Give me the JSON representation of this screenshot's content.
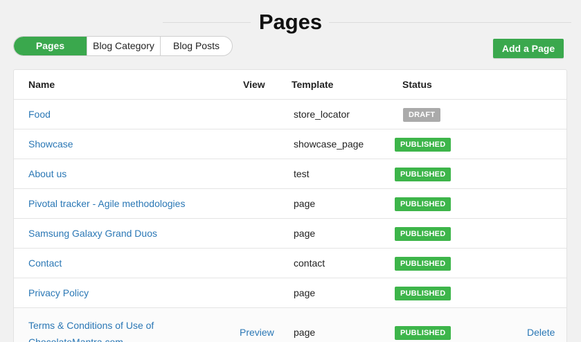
{
  "title": "Pages",
  "tabs": [
    {
      "label": "Pages",
      "active": true
    },
    {
      "label": "Blog Category",
      "active": false
    },
    {
      "label": "Blog Posts",
      "active": false
    }
  ],
  "add_button_label": "Add a Page",
  "table": {
    "headers": {
      "name": "Name",
      "view": "View",
      "template": "Template",
      "status": "Status"
    },
    "rows": [
      {
        "name": "Food",
        "view": "",
        "template": "store_locator",
        "status": "DRAFT",
        "delete": ""
      },
      {
        "name": "Showcase",
        "view": "",
        "template": "showcase_page",
        "status": "PUBLISHED",
        "delete": ""
      },
      {
        "name": "About us",
        "view": "",
        "template": "test",
        "status": "PUBLISHED",
        "delete": ""
      },
      {
        "name": "Pivotal tracker - Agile methodologies",
        "view": "",
        "template": "page",
        "status": "PUBLISHED",
        "delete": ""
      },
      {
        "name": "Samsung Galaxy Grand Duos",
        "view": "",
        "template": "page",
        "status": "PUBLISHED",
        "delete": ""
      },
      {
        "name": "Contact",
        "view": "",
        "template": "contact",
        "status": "PUBLISHED",
        "delete": ""
      },
      {
        "name": "Privacy Policy",
        "view": "",
        "template": "page",
        "status": "PUBLISHED",
        "delete": ""
      },
      {
        "name": "Terms & Conditions of Use of ChocolateMantra.com",
        "view": "Preview",
        "template": "page",
        "status": "PUBLISHED",
        "delete": "Delete"
      }
    ]
  },
  "colors": {
    "accent": "#3aa84d",
    "link": "#2a77b5",
    "published": "#3db54a",
    "draft": "#aaaaaa"
  }
}
